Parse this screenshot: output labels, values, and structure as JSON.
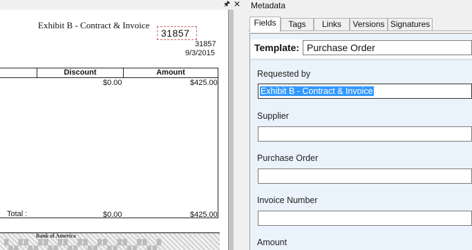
{
  "document_viewer": {
    "pin_icon": "pin-icon",
    "close_icon": "close-icon",
    "title": "Exhibit B - Contract & Invoice",
    "number_large": "31857",
    "number_small": "31857",
    "date": "9/3/2015",
    "table": {
      "headers": [
        "Discount",
        "Amount"
      ],
      "row": {
        "discount": "$0.00",
        "amount": "$425.00"
      },
      "total_label": "Total :",
      "total_discount": "$0.00",
      "total_amount": "$425.00"
    },
    "check_bank": "Bank of America"
  },
  "metadata": {
    "panel_title": "Metadata",
    "tabs": [
      {
        "label": "Fields",
        "active": true
      },
      {
        "label": "Tags",
        "active": false
      },
      {
        "label": "Links",
        "active": false
      },
      {
        "label": "Versions",
        "active": false
      },
      {
        "label": "Signatures",
        "active": false
      }
    ],
    "template_label": "Template:",
    "template_value": "Purchase Order",
    "fields": [
      {
        "label": "Requested by",
        "value": "Exhibit B - Contract & Invoice",
        "selected": true
      },
      {
        "label": "Supplier",
        "value": ""
      },
      {
        "label": "Purchase Order",
        "value": ""
      },
      {
        "label": "Invoice Number",
        "value": ""
      },
      {
        "label": "Amount",
        "value": ""
      }
    ]
  },
  "colors": {
    "selection": "#3399ff",
    "panel_background": "#eaf2fb",
    "annotation_dash": "#d45a5a"
  }
}
